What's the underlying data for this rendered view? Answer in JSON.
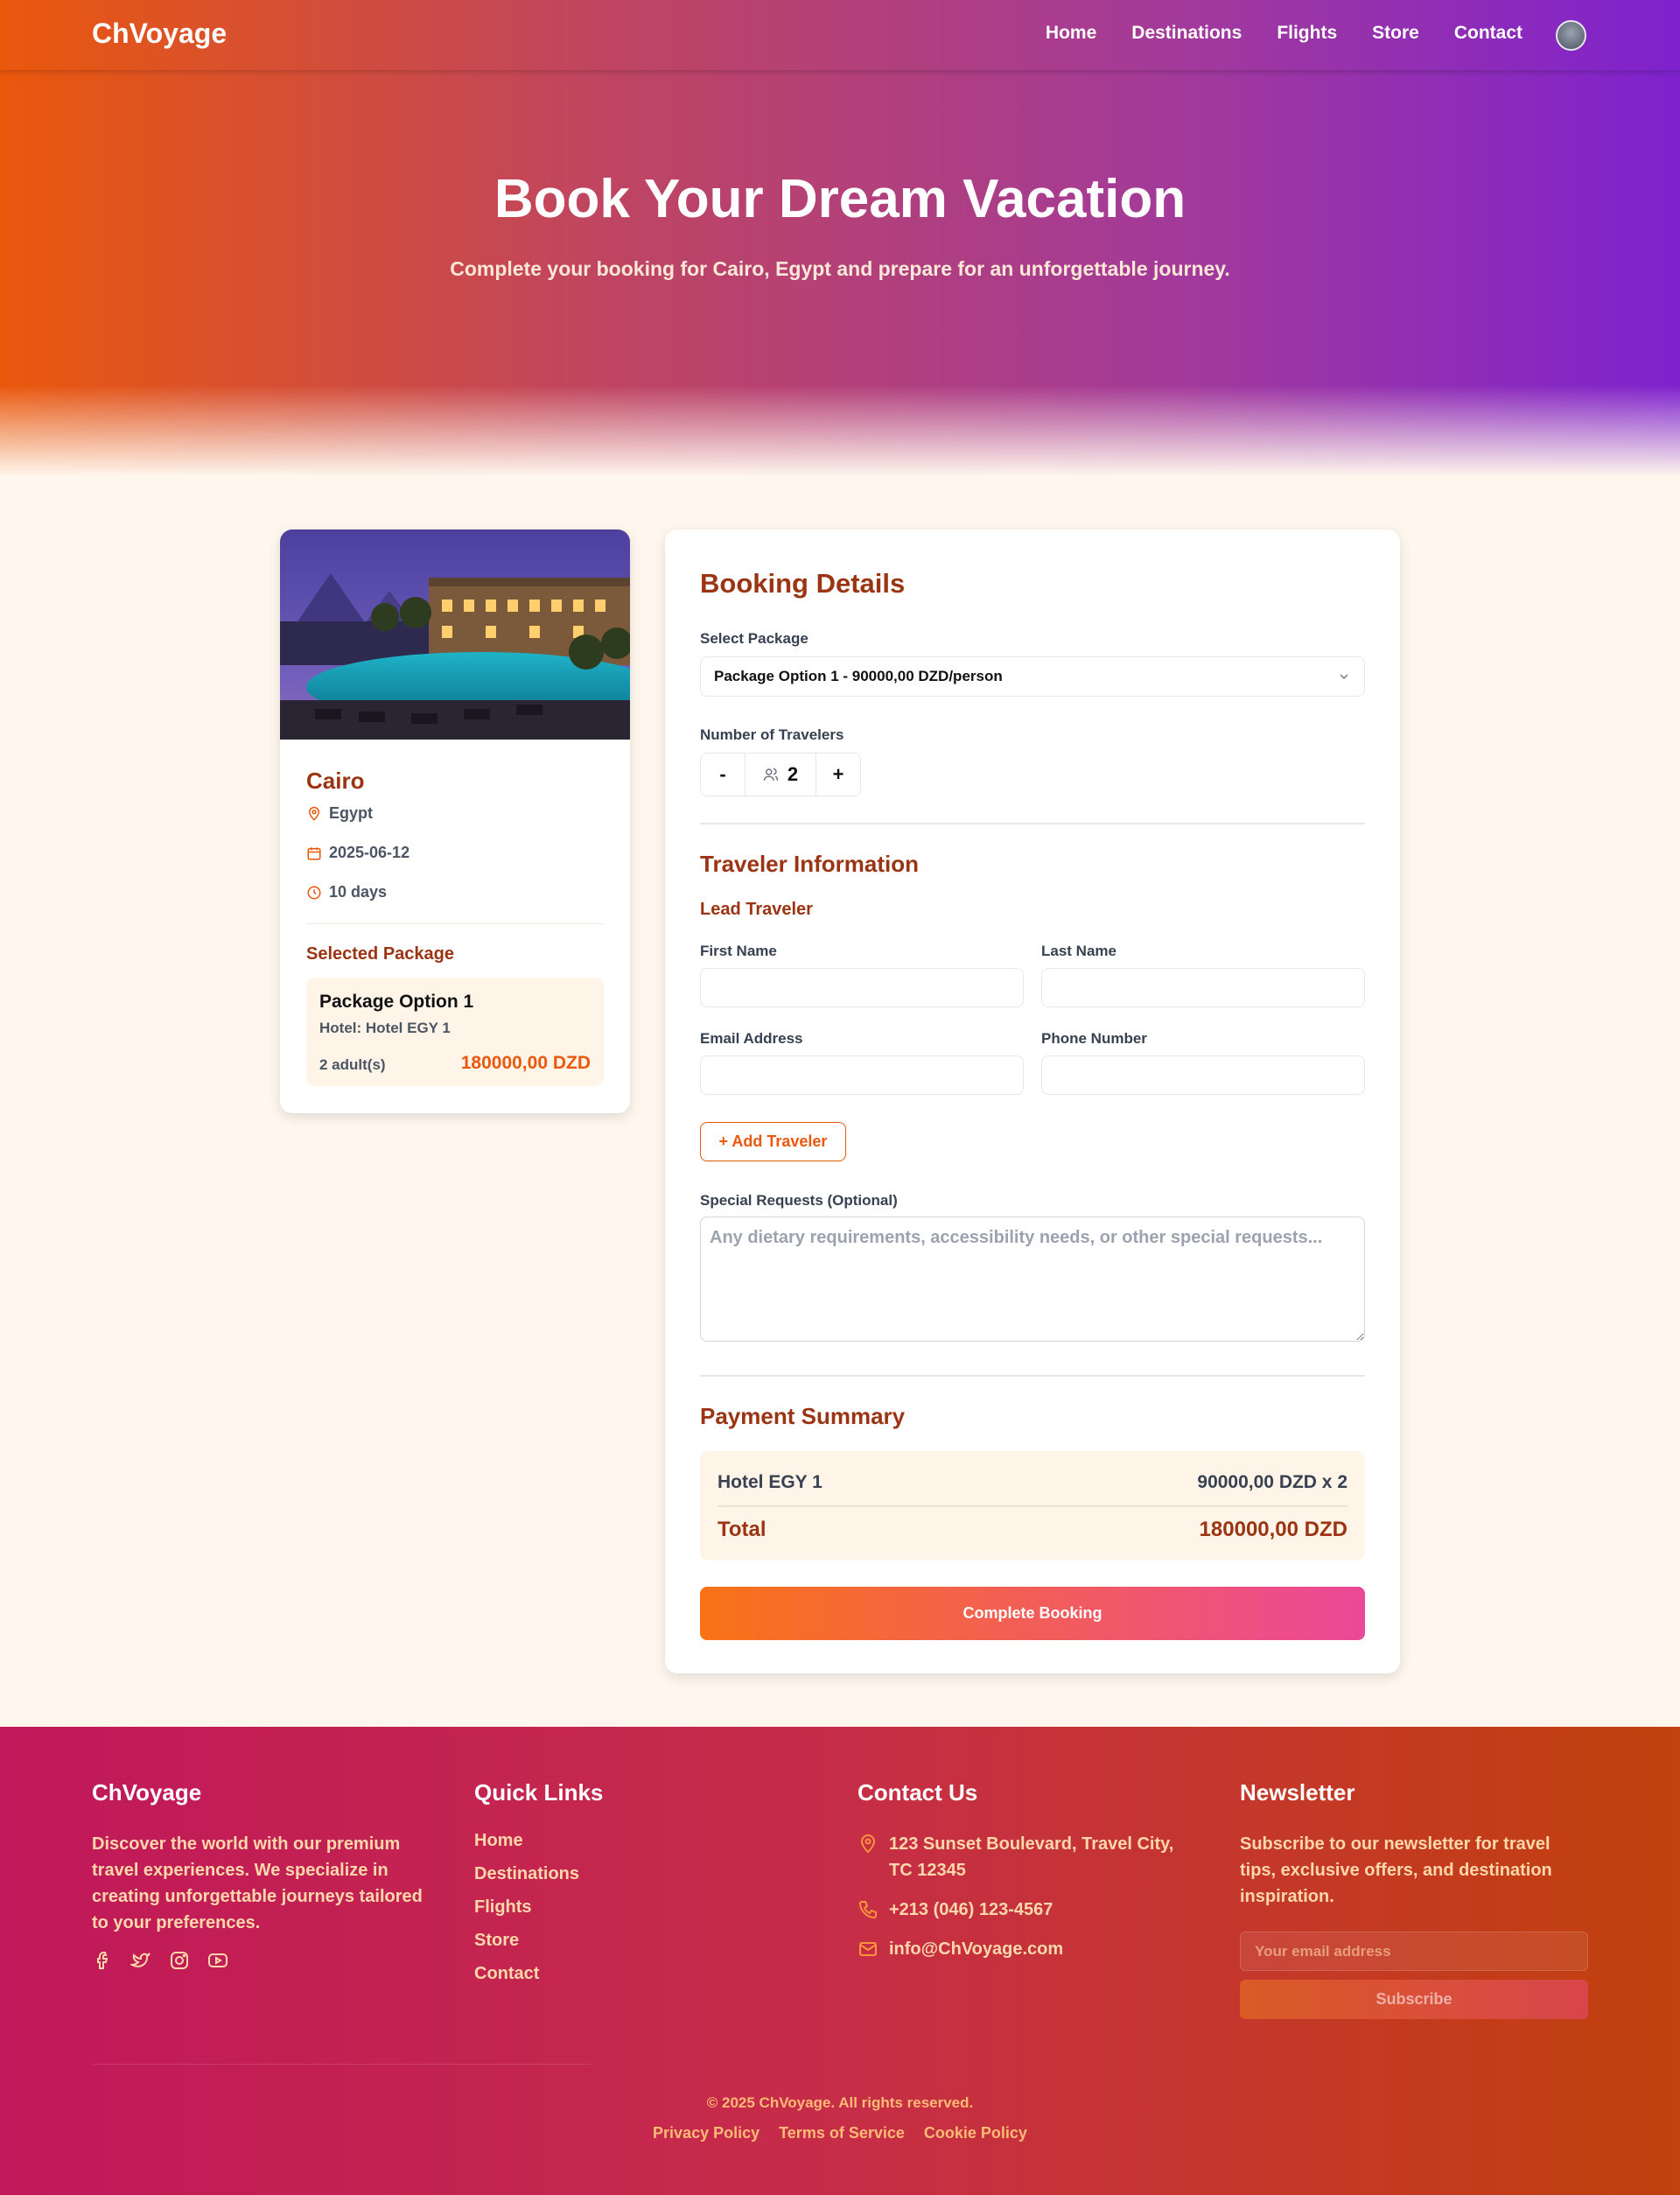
{
  "nav": {
    "brand": "ChVoyage",
    "links": [
      "Home",
      "Destinations",
      "Flights",
      "Store",
      "Contact"
    ]
  },
  "hero": {
    "title": "Book Your Dream Vacation",
    "subtitle": "Complete your booking for Cairo, Egypt and prepare for an unforgettable journey."
  },
  "destination": {
    "name": "Cairo",
    "country": "Egypt",
    "date": "2025-06-12",
    "duration": "10 days",
    "selected_package_title": "Selected Package",
    "package_name": "Package Option 1",
    "hotel": "Hotel: Hotel EGY 1",
    "adults": "2 adult(s)",
    "price": "180000,00 DZD"
  },
  "booking": {
    "title": "Booking Details",
    "select_package_label": "Select Package",
    "select_package_value": "Package Option 1 - 90000,00 DZD/person",
    "travelers_label": "Number of Travelers",
    "minus": "-",
    "plus": "+",
    "travelers_count": "2",
    "traveler_info_title": "Traveler Information",
    "lead_traveler": "Lead Traveler",
    "first_name_label": "First Name",
    "last_name_label": "Last Name",
    "email_label": "Email Address",
    "phone_label": "Phone Number",
    "add_traveler": "+ Add Traveler",
    "special_requests_label": "Special Requests (Optional)",
    "special_requests_placeholder": "Any dietary requirements, accessibility needs, or other special requests...",
    "payment_title": "Payment Summary",
    "line_item": "Hotel EGY 1",
    "line_amount": "90000,00 DZD x 2",
    "total_label": "Total",
    "total_amount": "180000,00 DZD",
    "complete_button": "Complete Booking"
  },
  "footer": {
    "brand": "ChVoyage",
    "about": "Discover the world with our premium travel experiences. We specialize in creating unforgettable journeys tailored to your preferences.",
    "quick_links_title": "Quick Links",
    "quick_links": [
      "Home",
      "Destinations",
      "Flights",
      "Store",
      "Contact"
    ],
    "contact_title": "Contact Us",
    "address": "123 Sunset Boulevard, Travel City, TC 12345",
    "phone": "+213 (046) 123-4567",
    "email": "info@ChVoyage.com",
    "newsletter_title": "Newsletter",
    "newsletter_text": "Subscribe to our newsletter for travel tips, exclusive offers, and destination inspiration.",
    "newsletter_placeholder": "Your email address",
    "subscribe": "Subscribe",
    "copyright": "© 2025 ChVoyage. All rights reserved.",
    "legal": [
      "Privacy Policy",
      "Terms of Service",
      "Cookie Policy"
    ]
  },
  "colors": {
    "accent": "#ea580c",
    "heading": "#9a3412",
    "hero_start": "#ea580c",
    "hero_end": "#7e22ce",
    "button_start": "#f97316",
    "button_end": "#ec4899"
  }
}
